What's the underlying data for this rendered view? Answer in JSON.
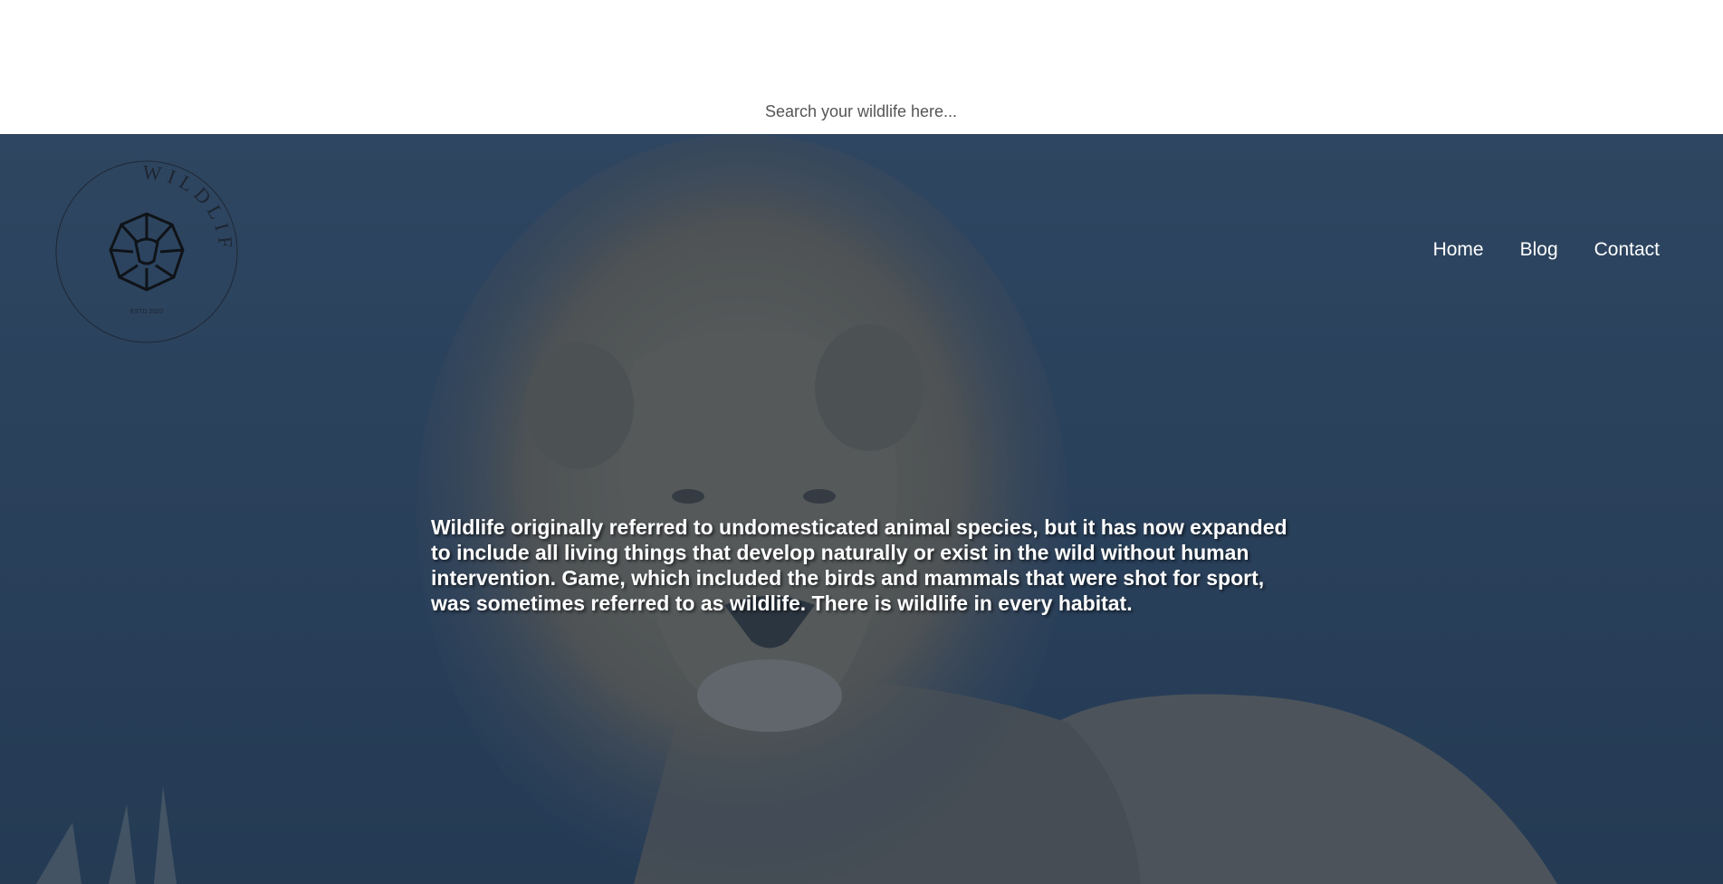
{
  "search": {
    "placeholder": "Search your wildlife here..."
  },
  "logo": {
    "arc_text": "WILDLIFE",
    "icon": "lion-head-icon",
    "subtext": "ESTD 2020"
  },
  "nav": {
    "items": [
      {
        "label": "Home"
      },
      {
        "label": "Blog"
      },
      {
        "label": "Contact"
      }
    ]
  },
  "hero": {
    "background": "lion-photo",
    "overlay_color": "#2b4463",
    "text": "Wildlife originally referred to undomesticated animal species, but it has now expanded to include all living things that develop naturally or exist in the wild without human intervention. Game, which included the birds and mammals that were shot for sport, was sometimes referred to as wildlife. There is wildlife in every habitat."
  }
}
